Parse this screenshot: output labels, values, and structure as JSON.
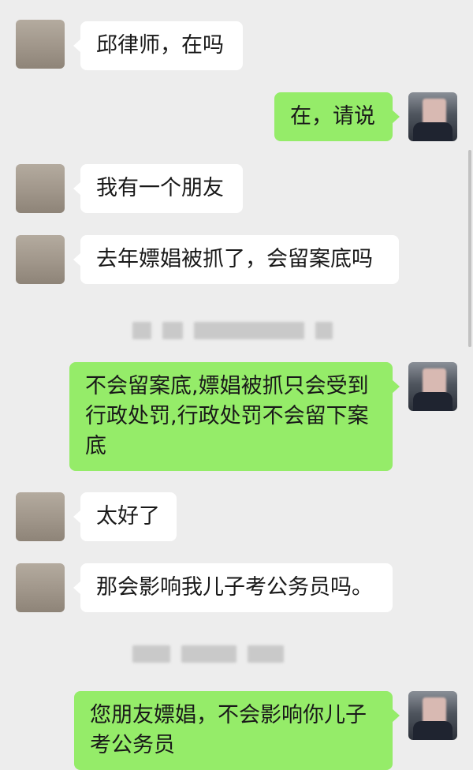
{
  "conversation": {
    "messages": [
      {
        "id": 1,
        "sender": "other",
        "text": "邱律师，在吗"
      },
      {
        "id": 2,
        "sender": "self",
        "text": "在，请说"
      },
      {
        "id": 3,
        "sender": "other",
        "text": "我有一个朋友"
      },
      {
        "id": 4,
        "sender": "other",
        "text": "去年嫖娼被抓了，会留案底吗"
      },
      {
        "id": 5,
        "sender": "self",
        "text": "不会留案底,嫖娼被抓只会受到行政处罚,行政处罚不会留下案底"
      },
      {
        "id": 6,
        "sender": "other",
        "text": "太好了"
      },
      {
        "id": 7,
        "sender": "other",
        "text": "那会影响我儿子考公务员吗。"
      },
      {
        "id": 8,
        "sender": "self",
        "text": "您朋友嫖娼，不会影响你儿子考公务员"
      }
    ],
    "timestamps": [
      "blurred-timestamp-1",
      "blurred-timestamp-2"
    ]
  },
  "avatars": {
    "other": "contact-avatar",
    "self": "lawyer-avatar-blurred"
  },
  "colors": {
    "background": "#ededed",
    "self_bubble": "#95ec69",
    "other_bubble": "#ffffff"
  }
}
